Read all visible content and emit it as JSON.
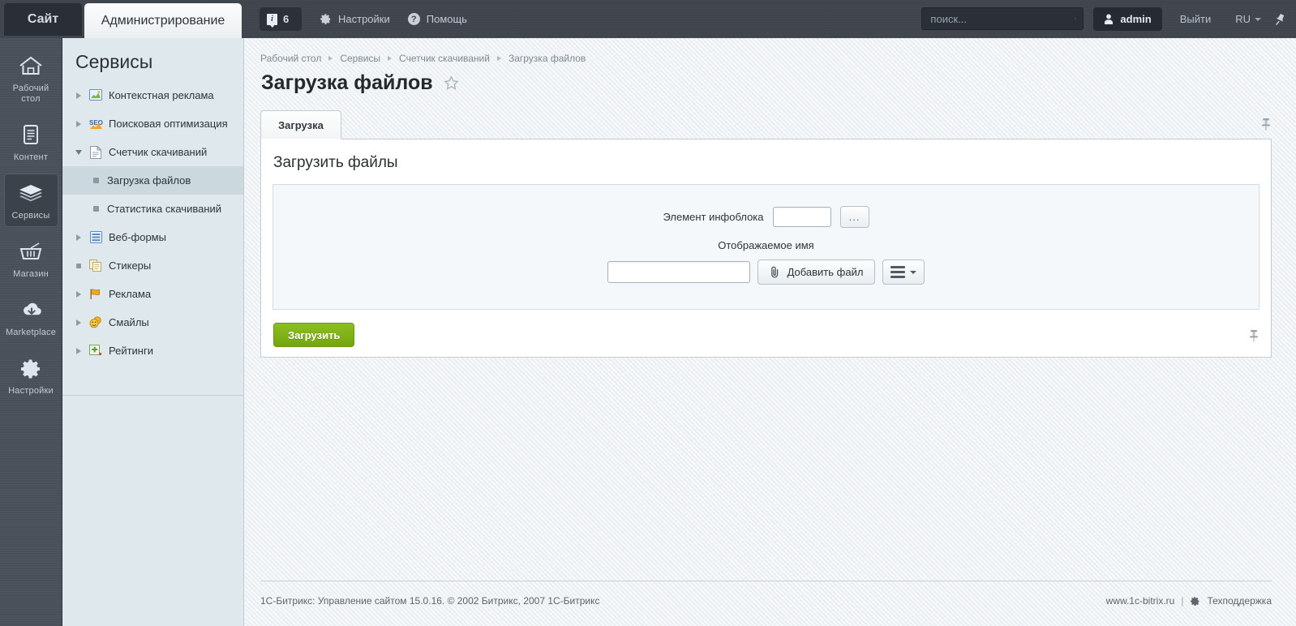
{
  "topbar": {
    "site_tab": "Сайт",
    "admin_tab": "Администрирование",
    "info_icon": "info-icon",
    "info_count": "6",
    "settings_icon": "gear-icon",
    "settings_label": "Настройки",
    "help_icon": "question-icon",
    "help_label": "Помощь",
    "search_placeholder": "поиск...",
    "search_value": "",
    "search_icon": "search-icon",
    "user_icon": "user-icon",
    "user_label": "admin",
    "logout_label": "Выйти",
    "lang_label": "RU",
    "lang_caret": "chevron-down-icon",
    "pin_icon": "pin-icon"
  },
  "rail": {
    "items": [
      {
        "label": "Рабочий\nстол",
        "icon": "home-icon",
        "active": false
      },
      {
        "label": "Контент",
        "icon": "document-icon",
        "active": false
      },
      {
        "label": "Сервисы",
        "icon": "layers-icon",
        "active": true
      },
      {
        "label": "Магазин",
        "icon": "basket-icon",
        "active": false
      },
      {
        "label": "Marketplace",
        "icon": "cloud-download-icon",
        "active": false
      },
      {
        "label": "Настройки",
        "icon": "gear-icon",
        "active": false
      }
    ]
  },
  "sidebar": {
    "title": "Сервисы",
    "items": [
      {
        "label": "Контекстная реклама",
        "marker": "arrow-right",
        "icon": "chart-image-icon"
      },
      {
        "label": "Поисковая оптимизация",
        "marker": "arrow-right",
        "icon": "seo-icon"
      },
      {
        "label": "Счетчик скачиваний",
        "marker": "arrow-down",
        "icon": "page-icon"
      }
    ],
    "sub_items": [
      {
        "label": "Загрузка файлов",
        "selected": true
      },
      {
        "label": "Статистика скачиваний",
        "selected": false
      }
    ],
    "items2": [
      {
        "label": "Веб-формы",
        "marker": "arrow-right",
        "icon": "webform-icon"
      },
      {
        "label": "Стикеры",
        "marker": "dot",
        "icon": "stickers-icon"
      },
      {
        "label": "Реклама",
        "marker": "arrow-right",
        "icon": "flag-icon"
      },
      {
        "label": "Смайлы",
        "marker": "arrow-right",
        "icon": "smiley-icon"
      },
      {
        "label": "Рейтинги",
        "marker": "arrow-right",
        "icon": "rating-plus-icon"
      }
    ]
  },
  "breadcrumb": {
    "items": [
      "Рабочий стол",
      "Сервисы",
      "Счетчик скачиваний",
      "Загрузка файлов"
    ]
  },
  "page": {
    "title": "Загрузка файлов",
    "star_icon": "star-icon",
    "tab_label": "Загрузка",
    "tab_pin_icon": "pin-icon",
    "panel_title": "Загрузить файлы"
  },
  "form": {
    "infoblock_label": "Элемент инфоблока",
    "infoblock_value": "",
    "browse_label": "...",
    "display_name_label": "Отображаемое имя",
    "display_name_value": "",
    "add_file_label": "Добавить файл",
    "clip_icon": "paperclip-icon",
    "menu_icon": "hamburger-icon",
    "menu_caret": "chevron-down-icon",
    "submit_label": "Загрузить",
    "bottom_pin_icon": "pin-icon"
  },
  "footer": {
    "copyright": "1С-Битрикс: Управление сайтом 15.0.16. © 2002 Битрикс, 2007 1С-Битрикс",
    "site_link": "www.1c-bitrix.ru",
    "separator": "|",
    "support_icon": "gear-icon",
    "support_link": "Техподдержка"
  },
  "colors": {
    "topbar": "#3f454d",
    "rail": "#4b525b",
    "sidebar": "#dfe8ec",
    "sidebar_selected": "#cbd8de",
    "content_bg": "#eef2f4",
    "panel": "#ffffff",
    "form_box": "#f4f8fa",
    "submit_green": "#7cb014",
    "border": "#c4ccd1"
  }
}
